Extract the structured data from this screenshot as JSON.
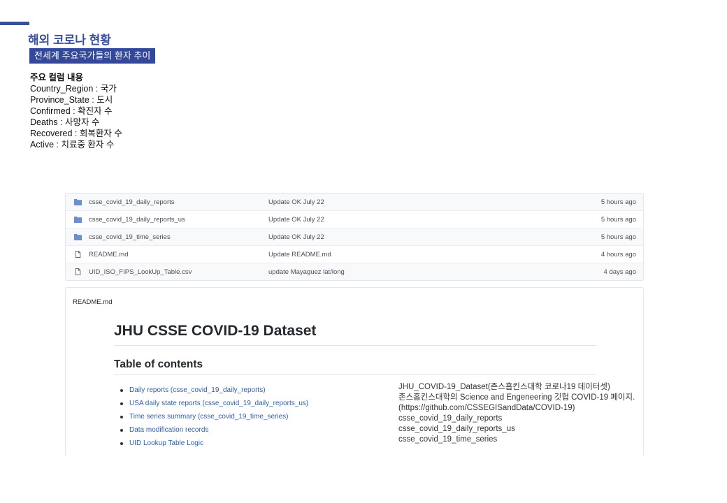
{
  "header": {
    "title": "해외 코로나 현황",
    "subtitle": "전세계 주요국가들의 환자 추이"
  },
  "columns": {
    "heading": "주요 컬럼 내용",
    "items": [
      "Country_Region : 국가",
      "Province_State : 도시",
      "Confirmed : 확진자 수",
      "Deaths : 사망자 수",
      "Recovered : 회복환자 수",
      "Active : 치료중 환자 수"
    ]
  },
  "files": [
    {
      "icon": "folder-icon",
      "name": "csse_covid_19_daily_reports",
      "message": "Update OK July 22",
      "time": "5 hours ago"
    },
    {
      "icon": "folder-icon",
      "name": "csse_covid_19_daily_reports_us",
      "message": "Update OK July 22",
      "time": "5 hours ago"
    },
    {
      "icon": "folder-icon",
      "name": "csse_covid_19_time_series",
      "message": "Update OK July 22",
      "time": "5 hours ago"
    },
    {
      "icon": "file-icon",
      "name": "README.md",
      "message": "Update README.md",
      "time": "4 hours ago"
    },
    {
      "icon": "file-icon",
      "name": "UID_ISO_FIPS_LookUp_Table.csv",
      "message": "update Mayaguez lat/long",
      "time": "4 days ago"
    }
  ],
  "readme": {
    "label": "README.md",
    "title": "JHU CSSE COVID-19 Dataset",
    "toc_heading": "Table of contents",
    "toc": [
      "Daily reports (csse_covid_19_daily_reports)",
      "USA daily state reports (csse_covid_19_daily_reports_us)",
      "Time series summary (csse_covid_19_time_series)",
      "Data modification records",
      "UID Lookup Table Logic"
    ],
    "note": [
      "JHU_COVID-19_Dataset(존스홉킨스대학 코로나19 데이터셋)",
      "존스홉킨스대학의 Science and Engeneering 깃헙 COVID-19 페이지.",
      "(https://github.com/CSSEGISandData/COVID-19)",
      "csse_covid_19_daily_reports",
      "csse_covid_19_daily_reports_us",
      "csse_covid_19_time_series"
    ]
  },
  "colors": {
    "accent": "#3a4f9c",
    "folder": "#6a8fd0",
    "link": "#2f5fa8"
  }
}
